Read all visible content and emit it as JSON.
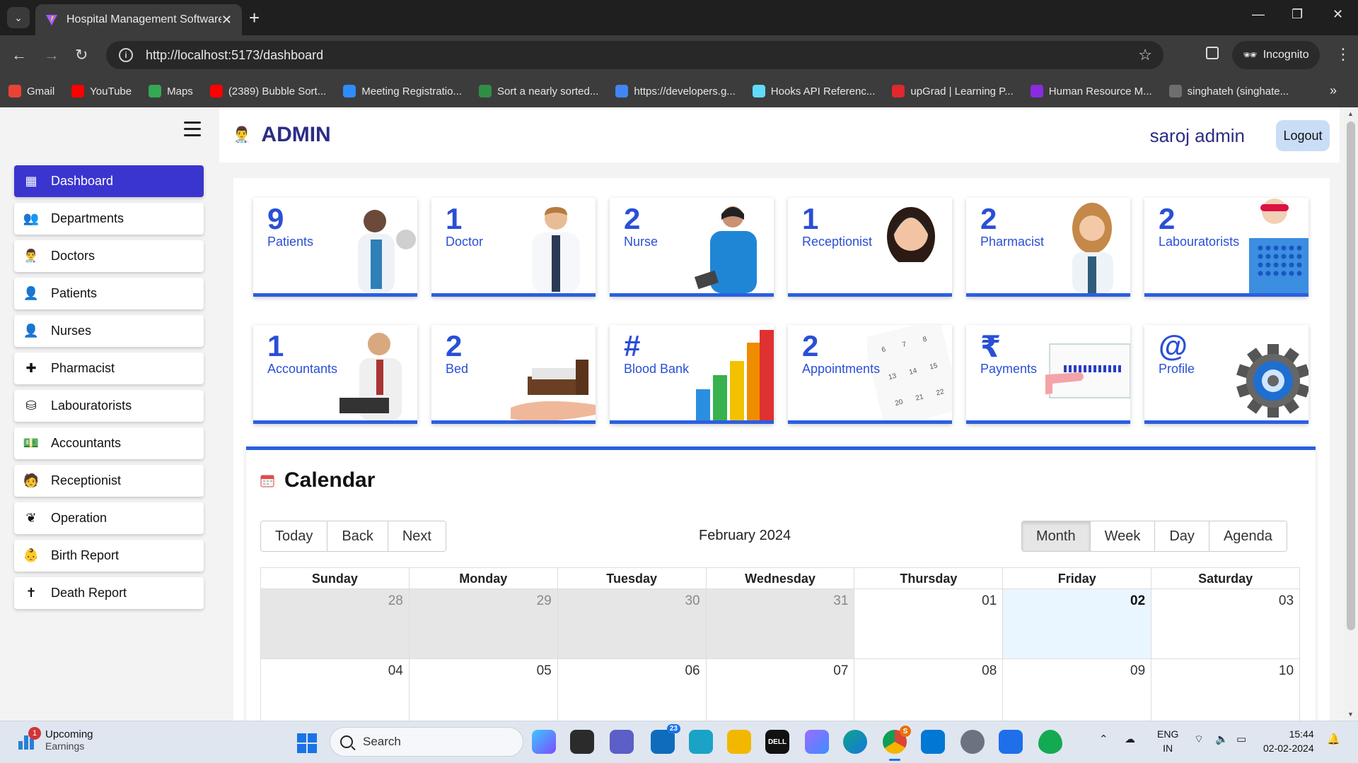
{
  "browser": {
    "tab_title": "Hospital Management Software",
    "url": "http://localhost:5173/dashboard",
    "incognito_label": "Incognito",
    "bookmarks": [
      {
        "label": "Gmail",
        "icon": "gmail-icon",
        "color": "#ea4335"
      },
      {
        "label": "YouTube",
        "icon": "youtube-icon",
        "color": "#ff0000"
      },
      {
        "label": "Maps",
        "icon": "maps-icon",
        "color": "#34a853"
      },
      {
        "label": "(2389) Bubble Sort...",
        "icon": "youtube-icon",
        "color": "#ff0000"
      },
      {
        "label": "Meeting Registratio...",
        "icon": "zoom-icon",
        "color": "#2d8cff"
      },
      {
        "label": "Sort a nearly sorted...",
        "icon": "gfg-icon",
        "color": "#2f8d46"
      },
      {
        "label": "https://developers.g...",
        "icon": "google-icon",
        "color": "#4285f4"
      },
      {
        "label": "Hooks API Referenc...",
        "icon": "react-icon",
        "color": "#61dafb"
      },
      {
        "label": "upGrad | Learning P...",
        "icon": "upgrad-icon",
        "color": "#e0282d"
      },
      {
        "label": "Human Resource M...",
        "icon": "hr-icon",
        "color": "#8a2be2"
      },
      {
        "label": "singhateh (singhate...",
        "icon": "github-icon",
        "color": "#6e6e6e"
      }
    ]
  },
  "sidebar": {
    "items": [
      {
        "label": "Dashboard",
        "icon": "dashboard-icon",
        "glyph": "▦"
      },
      {
        "label": "Departments",
        "icon": "departments-icon",
        "glyph": "👥"
      },
      {
        "label": "Doctors",
        "icon": "doctor-icon",
        "glyph": "👨‍⚕️"
      },
      {
        "label": "Patients",
        "icon": "patient-icon",
        "glyph": "👤"
      },
      {
        "label": "Nurses",
        "icon": "nurse-icon",
        "glyph": "👤"
      },
      {
        "label": "Pharmacist",
        "icon": "pharmacy-icon",
        "glyph": "✚"
      },
      {
        "label": "Labouratorists",
        "icon": "database-icon",
        "glyph": "⛁"
      },
      {
        "label": "Accountants",
        "icon": "money-icon",
        "glyph": "💵"
      },
      {
        "label": "Receptionist",
        "icon": "receptionist-icon",
        "glyph": "🧑"
      },
      {
        "label": "Operation",
        "icon": "operation-icon",
        "glyph": "❦"
      },
      {
        "label": "Birth Report",
        "icon": "baby-icon",
        "glyph": "👶"
      },
      {
        "label": "Death Report",
        "icon": "cross-icon",
        "glyph": "✝"
      }
    ]
  },
  "header": {
    "title": "ADMIN",
    "user_name": "saroj admin",
    "logout_label": "Logout"
  },
  "cards": [
    {
      "count": "9",
      "label": "Patients",
      "art": "doctor-with-patient-image"
    },
    {
      "count": "1",
      "label": "Doctor",
      "art": "doctor-image"
    },
    {
      "count": "2",
      "label": "Nurse",
      "art": "nurse-image"
    },
    {
      "count": "1",
      "label": "Receptionist",
      "art": "receptionist-image"
    },
    {
      "count": "2",
      "label": "Pharmacist",
      "art": "pharmacist-image"
    },
    {
      "count": "2",
      "label": "Labouratorists",
      "art": "lab-technician-image"
    },
    {
      "count": "1",
      "label": "Accountants",
      "art": "accountant-image"
    },
    {
      "count": "2",
      "label": "Bed",
      "art": "bed-in-hand-image"
    },
    {
      "count": "#",
      "label": "Blood Bank",
      "art": "bar-chart-image"
    },
    {
      "count": "2",
      "label": "Appointments",
      "art": "calendar-image"
    },
    {
      "count": "₹",
      "label": "Payments",
      "art": "card-payment-image"
    },
    {
      "count": "@",
      "label": "Profile",
      "art": "gear-image"
    }
  ],
  "calendar": {
    "title": "Calendar",
    "nav_buttons": [
      "Today",
      "Back",
      "Next"
    ],
    "month_label": "February 2024",
    "views": [
      "Month",
      "Week",
      "Day",
      "Agenda"
    ],
    "active_view": "Month",
    "weekdays": [
      "Sunday",
      "Monday",
      "Tuesday",
      "Wednesday",
      "Thursday",
      "Friday",
      "Saturday"
    ],
    "weeks": [
      [
        {
          "d": "28",
          "off": true
        },
        {
          "d": "29",
          "off": true
        },
        {
          "d": "30",
          "off": true
        },
        {
          "d": "31",
          "off": true
        },
        {
          "d": "01"
        },
        {
          "d": "02",
          "today": true
        },
        {
          "d": "03"
        }
      ],
      [
        {
          "d": "04"
        },
        {
          "d": "05"
        },
        {
          "d": "06"
        },
        {
          "d": "07"
        },
        {
          "d": "08"
        },
        {
          "d": "09"
        },
        {
          "d": "10"
        }
      ]
    ]
  },
  "taskbar": {
    "widget_title": "Upcoming",
    "widget_sub": "Earnings",
    "widget_badge": "1",
    "search_label": "Search",
    "mail_badge": "23",
    "chrome_badge": "S",
    "lang_top": "ENG",
    "lang_bottom": "IN",
    "time": "15:44",
    "date": "02-02-2024"
  }
}
